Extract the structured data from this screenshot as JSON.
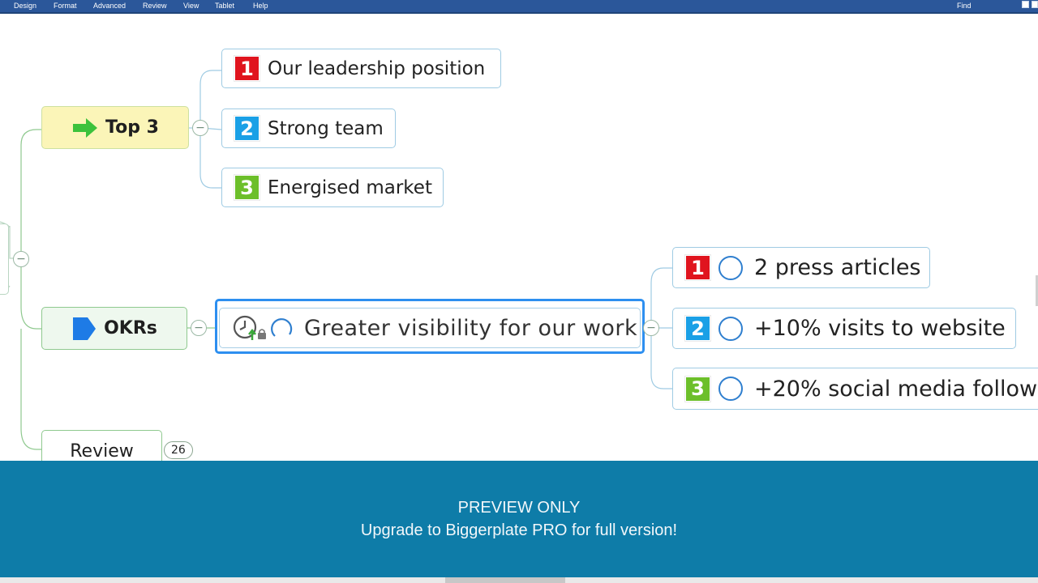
{
  "menu": {
    "items": [
      "Design",
      "Format",
      "Advanced",
      "Review",
      "View",
      "Tablet",
      "Help"
    ],
    "find_label": "Find"
  },
  "map": {
    "top3": {
      "label": "Top 3",
      "icon": "green-arrow-icon",
      "children": [
        {
          "priority": "1",
          "label": "Our leadership position"
        },
        {
          "priority": "2",
          "label": "Strong team"
        },
        {
          "priority": "3",
          "label": "Energised market"
        }
      ]
    },
    "okrs": {
      "label": "OKRs",
      "icon": "blue-tag-icon",
      "objective": {
        "label": "Greater visibility for our work",
        "icons": [
          "clock-up-icon",
          "lock-icon",
          "refresh-circle-icon"
        ]
      },
      "key_results": [
        {
          "priority": "1",
          "label": "2 press articles"
        },
        {
          "priority": "2",
          "label": "+10% visits to website"
        },
        {
          "priority": "3",
          "label": "+20% social media follow"
        }
      ]
    },
    "review": {
      "label": "Review",
      "count": "26"
    },
    "collapse_symbol": "−"
  },
  "banner": {
    "line1": "PREVIEW ONLY",
    "line2": "Upgrade to Biggerplate PRO for full version!"
  },
  "colors": {
    "priority1": "#e0141e",
    "priority2": "#1aa0e6",
    "priority3": "#6cbf2a",
    "ribbon": "#2b579a",
    "banner": "#0e7ca8",
    "top3_fill": "#fbf5b8",
    "okrs_fill": "#eef8ee",
    "selection": "#2d8ff0"
  }
}
